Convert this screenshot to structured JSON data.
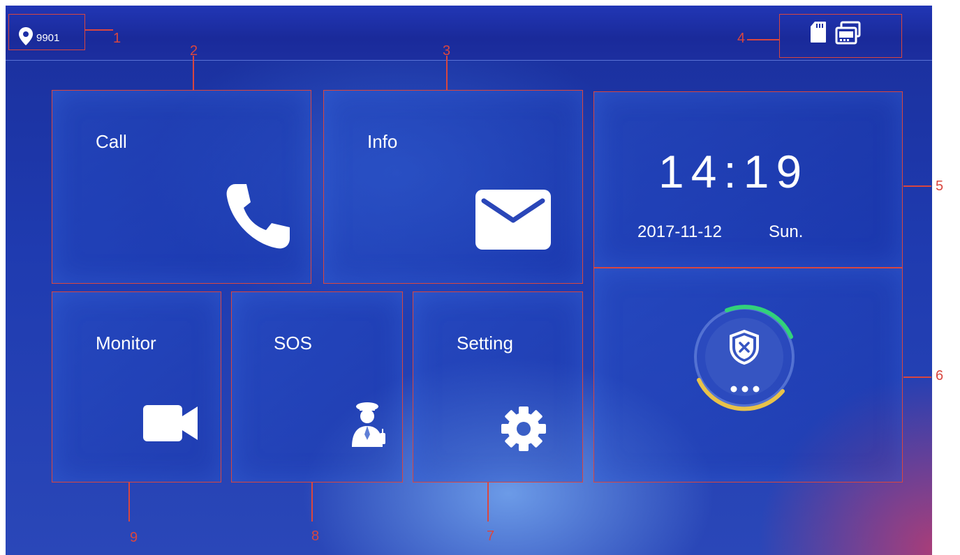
{
  "status_bar": {
    "room_number": "9901",
    "location_icon": "map-pin-icon",
    "status_icons": [
      "sd-card-icon",
      "multi-screen-icon"
    ]
  },
  "tiles": {
    "call": {
      "label": "Call",
      "icon": "phone-icon"
    },
    "info": {
      "label": "Info",
      "icon": "envelope-icon"
    },
    "monitor": {
      "label": "Monitor",
      "icon": "video-camera-icon"
    },
    "sos": {
      "label": "SOS",
      "icon": "security-guard-icon"
    },
    "setting": {
      "label": "Setting",
      "icon": "gear-icon"
    }
  },
  "clock": {
    "time": "14:19",
    "date": "2017-11-12",
    "weekday": "Sun."
  },
  "arm_status": {
    "icon": "shield-x-icon",
    "more_icon": "more-dots-icon"
  },
  "callouts": [
    "1",
    "2",
    "3",
    "4",
    "5",
    "6",
    "7",
    "8",
    "9"
  ],
  "colors": {
    "callout": "#d9463f",
    "background_top": "#1a2f9c",
    "ring_green": "#32d27a",
    "ring_yellow": "#e8c24a"
  }
}
